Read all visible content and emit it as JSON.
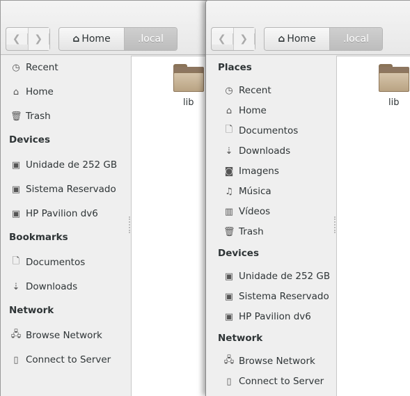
{
  "windows": [
    {
      "nav": {
        "back_icon": "chevron-left-icon",
        "forward_icon": "chevron-right-icon"
      },
      "path": {
        "home_label": "Home",
        "current_label": ".local"
      },
      "sidebar": [
        {
          "type": "item",
          "label": "Recent",
          "icon": "clock-icon"
        },
        {
          "type": "item",
          "label": "Home",
          "icon": "home-icon"
        },
        {
          "type": "item",
          "label": "Trash",
          "icon": "trash-icon"
        },
        {
          "type": "section",
          "label": "Devices"
        },
        {
          "type": "item",
          "label": "Unidade de 252 GB",
          "icon": "drive-icon"
        },
        {
          "type": "item",
          "label": "Sistema Reservado",
          "icon": "drive-icon"
        },
        {
          "type": "item",
          "label": "HP Pavilion dv6",
          "icon": "drive-icon"
        },
        {
          "type": "section",
          "label": "Bookmarks"
        },
        {
          "type": "item",
          "label": "Documentos",
          "icon": "document-icon"
        },
        {
          "type": "item",
          "label": "Downloads",
          "icon": "download-icon"
        },
        {
          "type": "section",
          "label": "Network"
        },
        {
          "type": "item",
          "label": "Browse Network",
          "icon": "network-icon"
        },
        {
          "type": "item",
          "label": "Connect to Server",
          "icon": "server-icon"
        }
      ],
      "files": [
        {
          "name": "lib",
          "icon": "folder-icon"
        }
      ]
    },
    {
      "nav": {
        "back_icon": "chevron-left-icon",
        "forward_icon": "chevron-right-icon"
      },
      "path": {
        "home_label": "Home",
        "current_label": ".local"
      },
      "sidebar": [
        {
          "type": "section",
          "label": "Places"
        },
        {
          "type": "item",
          "label": "Recent",
          "icon": "clock-icon"
        },
        {
          "type": "item",
          "label": "Home",
          "icon": "home-icon"
        },
        {
          "type": "item",
          "label": "Documentos",
          "icon": "document-icon"
        },
        {
          "type": "item",
          "label": "Downloads",
          "icon": "download-icon"
        },
        {
          "type": "item",
          "label": "Imagens",
          "icon": "camera-icon"
        },
        {
          "type": "item",
          "label": "Música",
          "icon": "music-icon"
        },
        {
          "type": "item",
          "label": "Vídeos",
          "icon": "film-icon"
        },
        {
          "type": "item",
          "label": "Trash",
          "icon": "trash-icon"
        },
        {
          "type": "section",
          "label": "Devices"
        },
        {
          "type": "item",
          "label": "Unidade de 252 GB",
          "icon": "drive-icon"
        },
        {
          "type": "item",
          "label": "Sistema Reservado",
          "icon": "drive-icon"
        },
        {
          "type": "item",
          "label": "HP Pavilion dv6",
          "icon": "drive-icon"
        },
        {
          "type": "section",
          "label": "Network"
        },
        {
          "type": "item",
          "label": "Browse Network",
          "icon": "network-icon"
        },
        {
          "type": "item",
          "label": "Connect to Server",
          "icon": "server-icon"
        }
      ],
      "files": [
        {
          "name": "lib",
          "icon": "folder-icon"
        }
      ]
    }
  ]
}
